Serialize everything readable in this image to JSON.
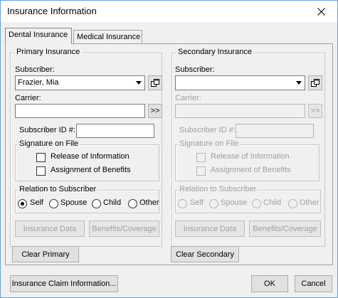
{
  "window": {
    "title": "Insurance Information",
    "close_icon": "close-icon"
  },
  "tabs": [
    {
      "label": "Dental Insurance",
      "active": true
    },
    {
      "label": "Medical Insurance",
      "active": false
    }
  ],
  "primary": {
    "title": "Primary Insurance",
    "subscriber_label": "Subscriber:",
    "subscriber_value": "Frazier, Mia",
    "carrier_label": "Carrier:",
    "carrier_value": "",
    "carrier_button": ">>",
    "subscriber_id_label": "Subscriber ID #:",
    "subscriber_id_value": "",
    "signature_title": "Signature on File",
    "release_label": "Release of Information",
    "assignment_label": "Assignment of Benefits",
    "relation_title": "Relation to Subscriber",
    "relation_options": [
      "Self",
      "Spouse",
      "Child",
      "Other"
    ],
    "relation_selected": "Self",
    "insurance_data_button": "Insurance Data",
    "benefits_button": "Benefits/Coverage",
    "clear_button": "Clear Primary"
  },
  "secondary": {
    "title": "Secondary Insurance",
    "subscriber_label": "Subscriber:",
    "subscriber_value": "",
    "carrier_label": "Carrier:",
    "carrier_value": "",
    "carrier_button": ">>",
    "subscriber_id_label": "Subscriber ID #:",
    "subscriber_id_value": "",
    "signature_title": "Signature on File",
    "release_label": "Release of Information",
    "assignment_label": "Assignment of Benefits",
    "relation_title": "Relation to Subscriber",
    "relation_options": [
      "Self",
      "Spouse",
      "Child",
      "Other"
    ],
    "relation_selected": "",
    "insurance_data_button": "Insurance Data",
    "benefits_button": "Benefits/Coverage",
    "clear_button": "Clear Secondary"
  },
  "footer": {
    "claim_button": "Insurance Claim Information...",
    "ok_button": "OK",
    "cancel_button": "Cancel"
  },
  "colors": {
    "window_border": "#6a9fd4",
    "dialog_bg": "#f0f0f0",
    "disabled_text": "#a0a0a0"
  }
}
